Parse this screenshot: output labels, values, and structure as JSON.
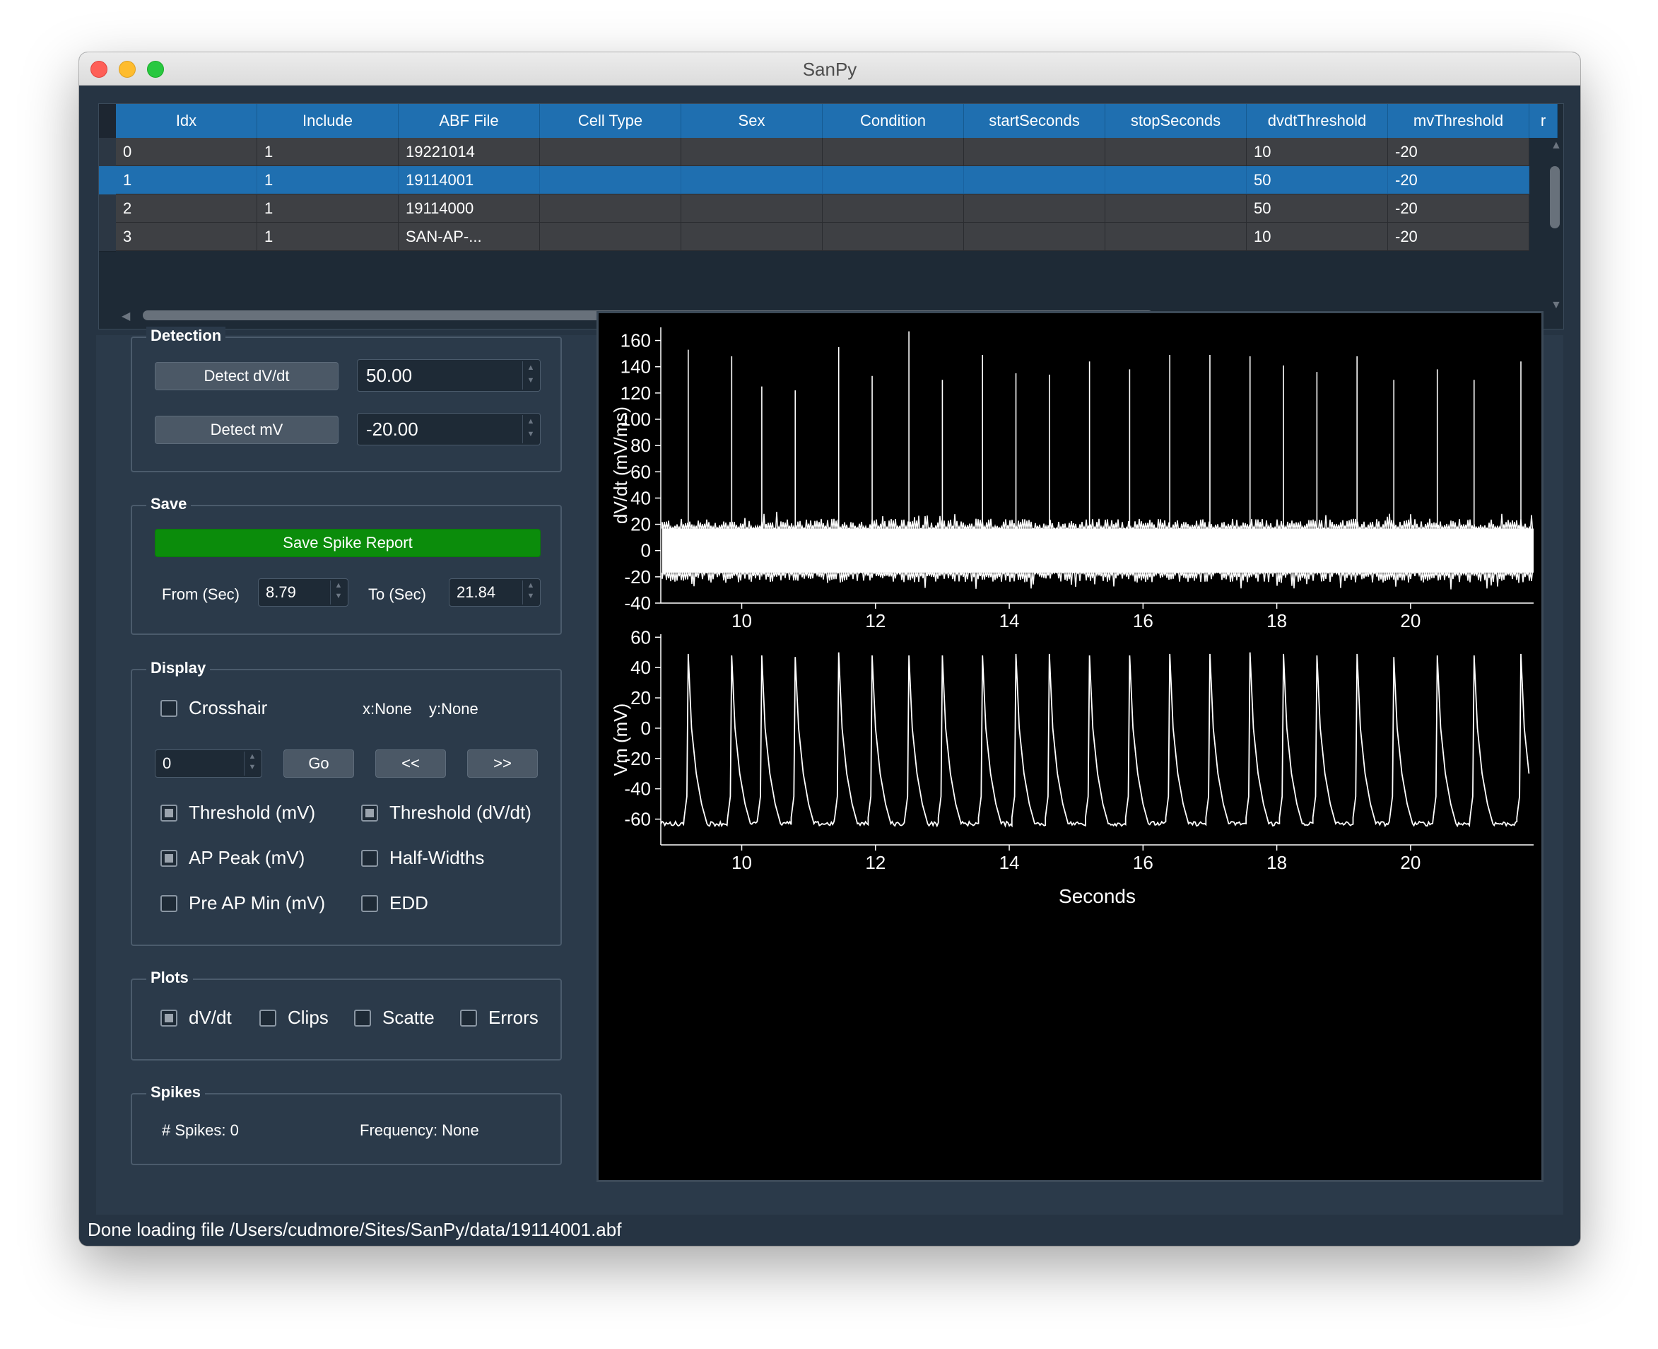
{
  "window": {
    "title": "SanPy"
  },
  "table": {
    "columns": [
      "Idx",
      "Include",
      "ABF File",
      "Cell Type",
      "Sex",
      "Condition",
      "startSeconds",
      "stopSeconds",
      "dvdtThreshold",
      "mvThreshold",
      "r"
    ],
    "rows": [
      [
        "0",
        "1",
        "19221014",
        "",
        "",
        "",
        "",
        "",
        "10",
        "-20"
      ],
      [
        "1",
        "1",
        "19114001",
        "",
        "",
        "",
        "",
        "",
        "50",
        "-20"
      ],
      [
        "2",
        "1",
        "19114000",
        "",
        "",
        "",
        "",
        "",
        "50",
        "-20"
      ],
      [
        "3",
        "1",
        "SAN-AP-...",
        "",
        "",
        "",
        "",
        "",
        "10",
        "-20"
      ]
    ],
    "selected_row": 1
  },
  "detection": {
    "title": "Detection",
    "detect_dvdt_label": "Detect dV/dt",
    "detect_dvdt_value": "50.00",
    "detect_mv_label": "Detect mV",
    "detect_mv_value": "-20.00"
  },
  "save": {
    "title": "Save",
    "button_label": "Save Spike Report",
    "from_label": "From (Sec)",
    "from_value": "8.79",
    "to_label": "To (Sec)",
    "to_value": "21.84"
  },
  "display": {
    "title": "Display",
    "crosshair_label": "Crosshair",
    "crosshair_checked": false,
    "x_readout": "x:None",
    "y_readout": "y:None",
    "goto_value": "0",
    "go_label": "Go",
    "prev_label": "<<",
    "next_label": ">>",
    "threshold_mv_label": "Threshold (mV)",
    "threshold_mv_checked": true,
    "threshold_dvdt_label": "Threshold (dV/dt)",
    "threshold_dvdt_checked": true,
    "ap_peak_label": "AP Peak (mV)",
    "ap_peak_checked": true,
    "half_widths_label": "Half-Widths",
    "half_widths_checked": false,
    "pre_ap_min_label": "Pre AP Min (mV)",
    "pre_ap_min_checked": false,
    "edd_label": "EDD",
    "edd_checked": false
  },
  "plots": {
    "title": "Plots",
    "dvdt_label": "dV/dt",
    "dvdt_checked": true,
    "clips_label": "Clips",
    "clips_checked": false,
    "scatter_label": "Scatte",
    "scatter_checked": false,
    "errors_label": "Errors",
    "errors_checked": false
  },
  "spikes": {
    "title": "Spikes",
    "count_text": "# Spikes: 0",
    "frequency_text": "Frequency: None"
  },
  "status": {
    "message": "Done loading file /Users/cudmore/Sites/SanPy/data/19114001.abf"
  },
  "colors": {
    "accent": "#1f6fb0",
    "save_button": "#0b8c0b",
    "trace": "#ffffff",
    "plot_bg": "#000000"
  },
  "chart_data": [
    {
      "type": "line",
      "ylabel": "dV/dt (mV/ms)",
      "xlabel": "",
      "xlim": [
        8.79,
        21.84
      ],
      "ylim": [
        -40,
        170
      ],
      "x_ticks": [
        10,
        12,
        14,
        16,
        18,
        20
      ],
      "y_ticks": [
        -40,
        -20,
        0,
        20,
        40,
        60,
        80,
        100,
        120,
        140,
        160
      ],
      "noise_band": [
        -20,
        20
      ],
      "spike_times": [
        9.2,
        9.85,
        10.3,
        10.8,
        11.45,
        11.95,
        12.5,
        13.0,
        13.6,
        14.1,
        14.6,
        15.2,
        15.8,
        16.4,
        17.0,
        17.6,
        18.1,
        18.6,
        19.2,
        19.75,
        20.4,
        20.95,
        21.65
      ],
      "spike_peaks": [
        153,
        148,
        125,
        122,
        155,
        133,
        167,
        130,
        149,
        135,
        134,
        144,
        138,
        149,
        149,
        148,
        141,
        136,
        148,
        130,
        138,
        130,
        144
      ]
    },
    {
      "type": "line",
      "ylabel": "Vm (mV)",
      "xlabel": "Seconds",
      "xlim": [
        8.79,
        21.84
      ],
      "ylim": [
        -77,
        62
      ],
      "x_ticks": [
        10,
        12,
        14,
        16,
        18,
        20
      ],
      "y_ticks": [
        -60,
        -40,
        -20,
        0,
        20,
        40,
        60
      ],
      "baseline": -63,
      "spike_times": [
        9.2,
        9.85,
        10.3,
        10.8,
        11.45,
        11.95,
        12.5,
        13.0,
        13.6,
        14.1,
        14.6,
        15.2,
        15.8,
        16.4,
        17.0,
        17.6,
        18.1,
        18.6,
        19.2,
        19.75,
        20.4,
        20.95,
        21.65
      ],
      "spike_peaks": [
        49,
        48,
        48,
        47,
        50,
        48,
        48,
        48,
        48,
        49,
        49,
        48,
        48,
        49,
        49,
        50,
        49,
        48,
        49,
        47,
        48,
        48,
        49
      ]
    }
  ]
}
